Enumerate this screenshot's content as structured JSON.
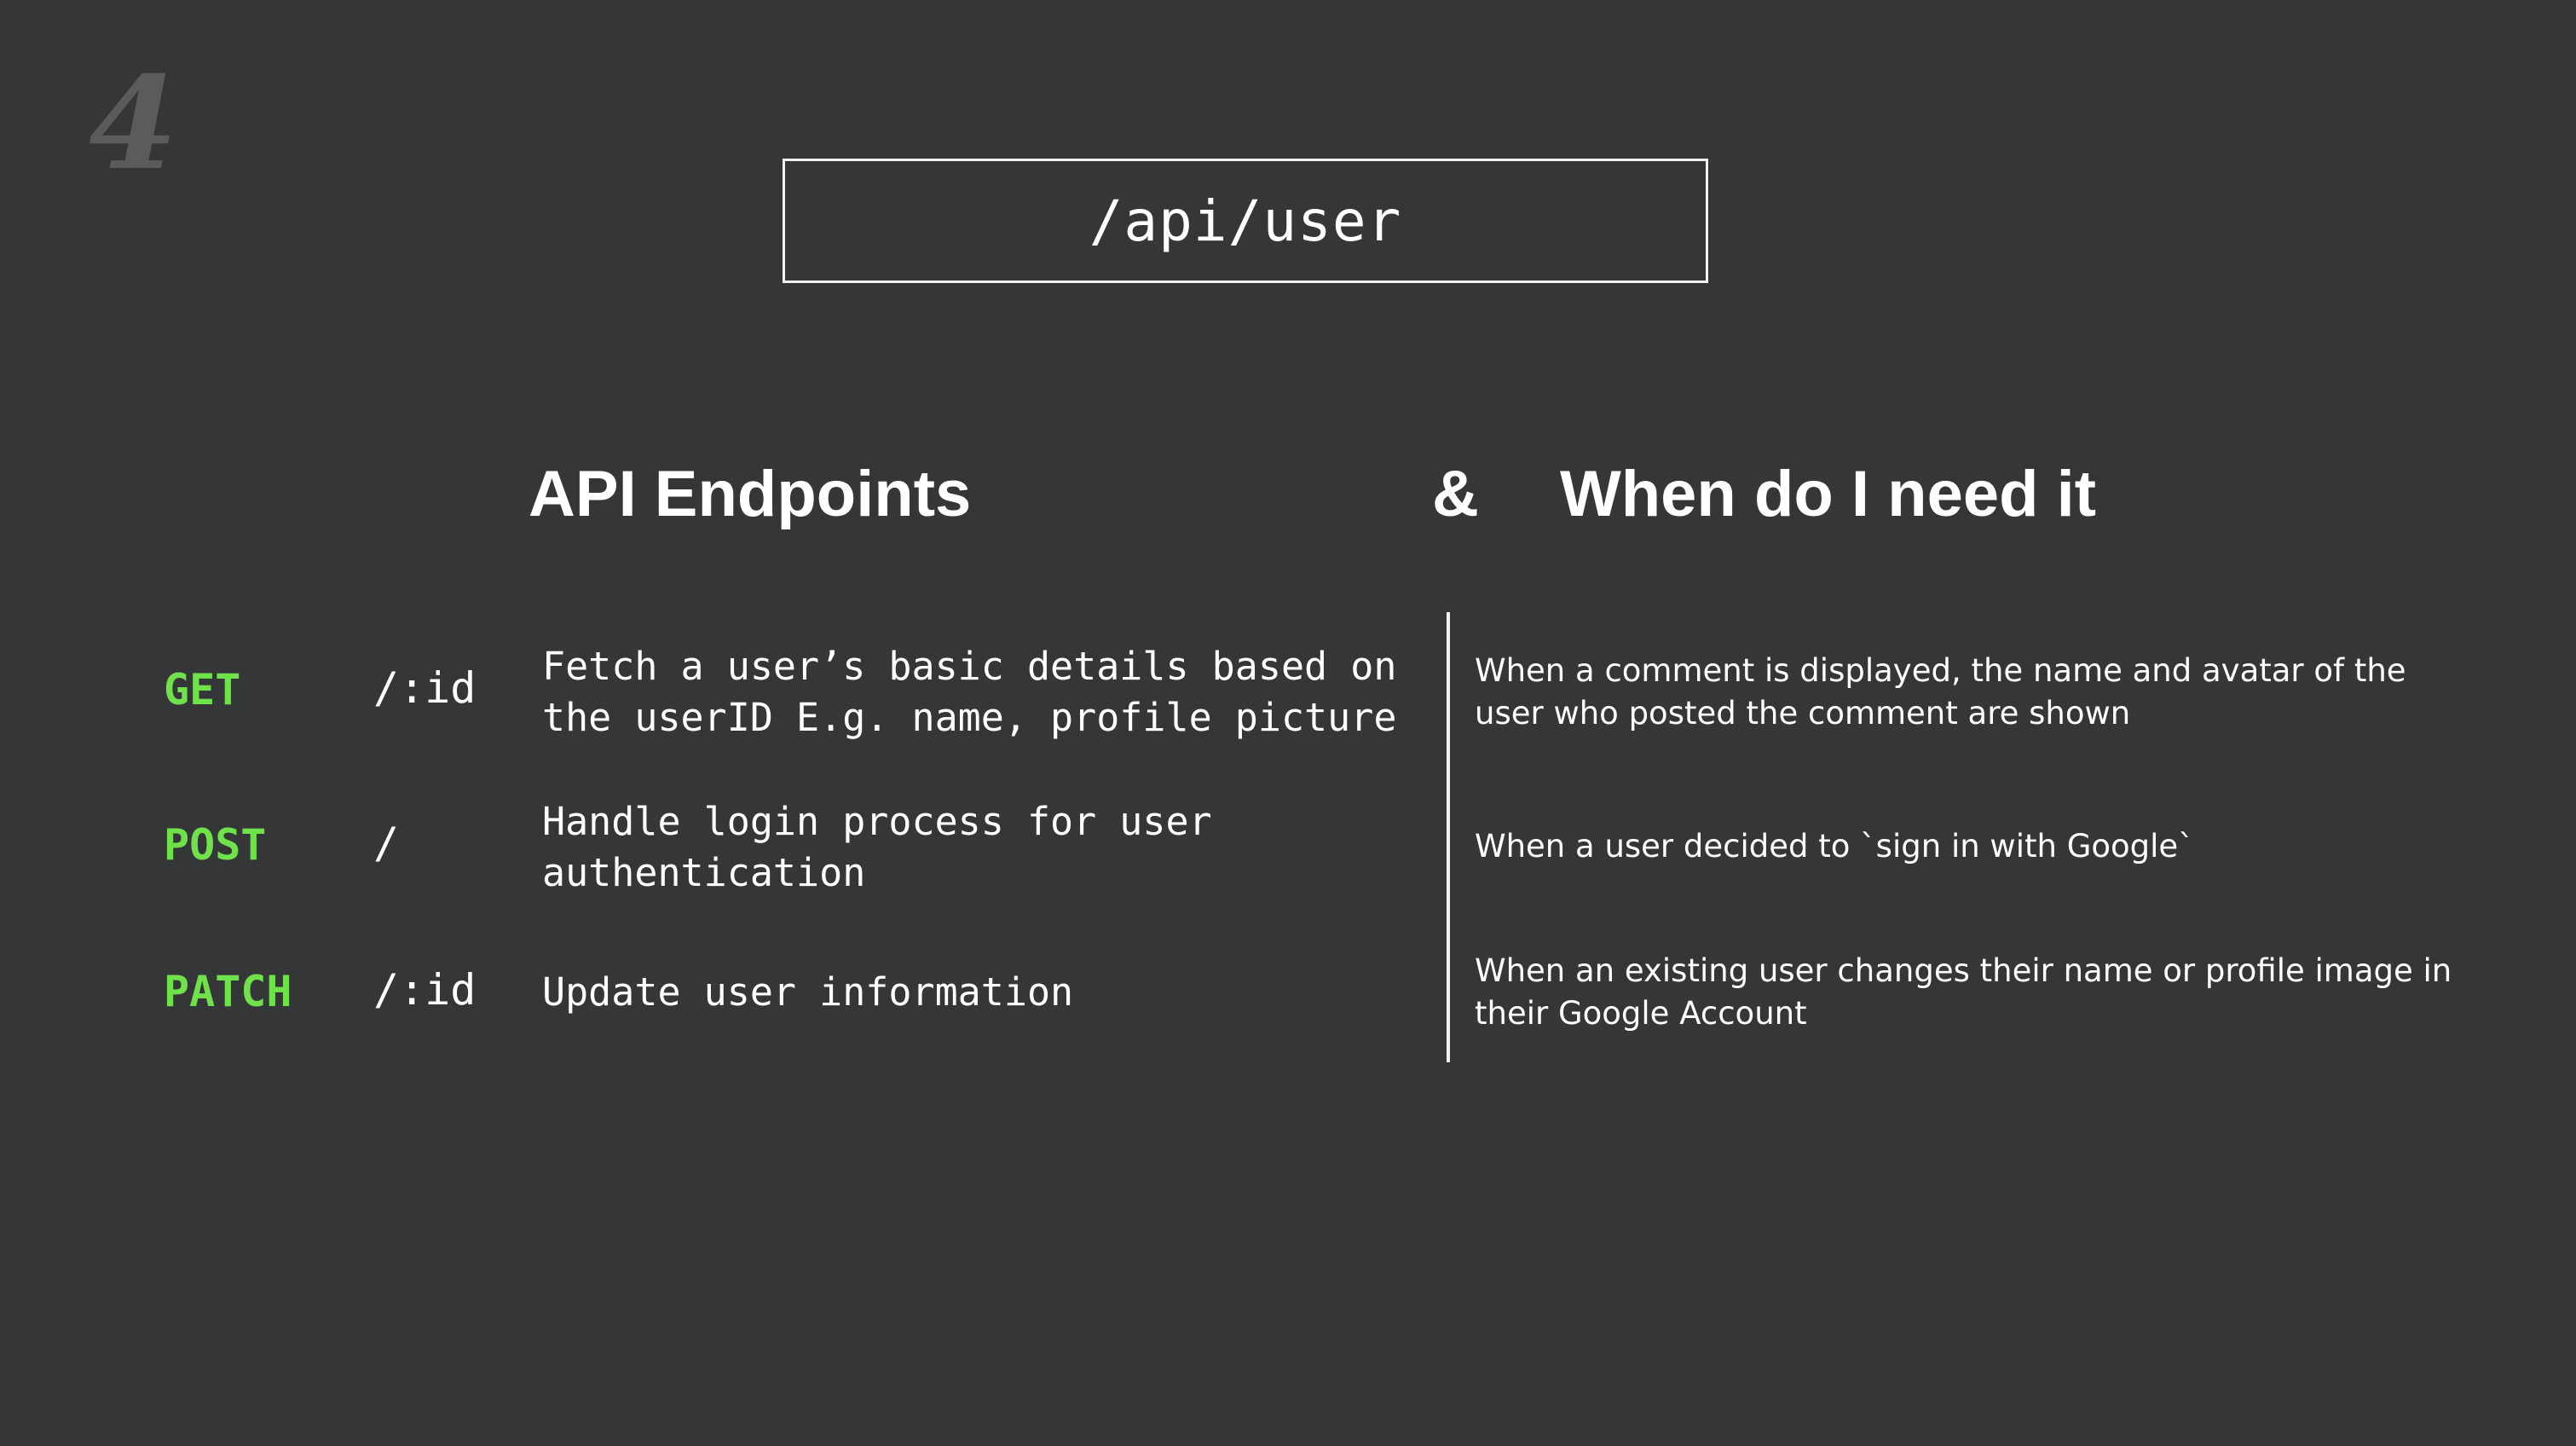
{
  "slide": {
    "number": "4"
  },
  "route": {
    "label": "/api/user"
  },
  "headings": {
    "endpoints": "API Endpoints",
    "ampersand": "&",
    "when": "When do I need it"
  },
  "endpoints": [
    {
      "method": "GET",
      "path": "/:id",
      "description": "Fetch a user’s basic details based on\nthe userID E.g. name, profile picture",
      "when": "When a comment is displayed, the name and avatar of the user who posted the comment are shown"
    },
    {
      "method": "POST",
      "path": "/",
      "description": "Handle login process for user\nauthentication",
      "when": "When a user decided to `sign in with Google`"
    },
    {
      "method": "PATCH",
      "path": "/:id",
      "description": "Update user information",
      "when": "When an existing user changes their name or profile image in their Google Account"
    }
  ],
  "colors": {
    "background": "#353638",
    "method": "#6fe14a",
    "text": "#ffffff",
    "slide_number": "#5a5b5d"
  }
}
